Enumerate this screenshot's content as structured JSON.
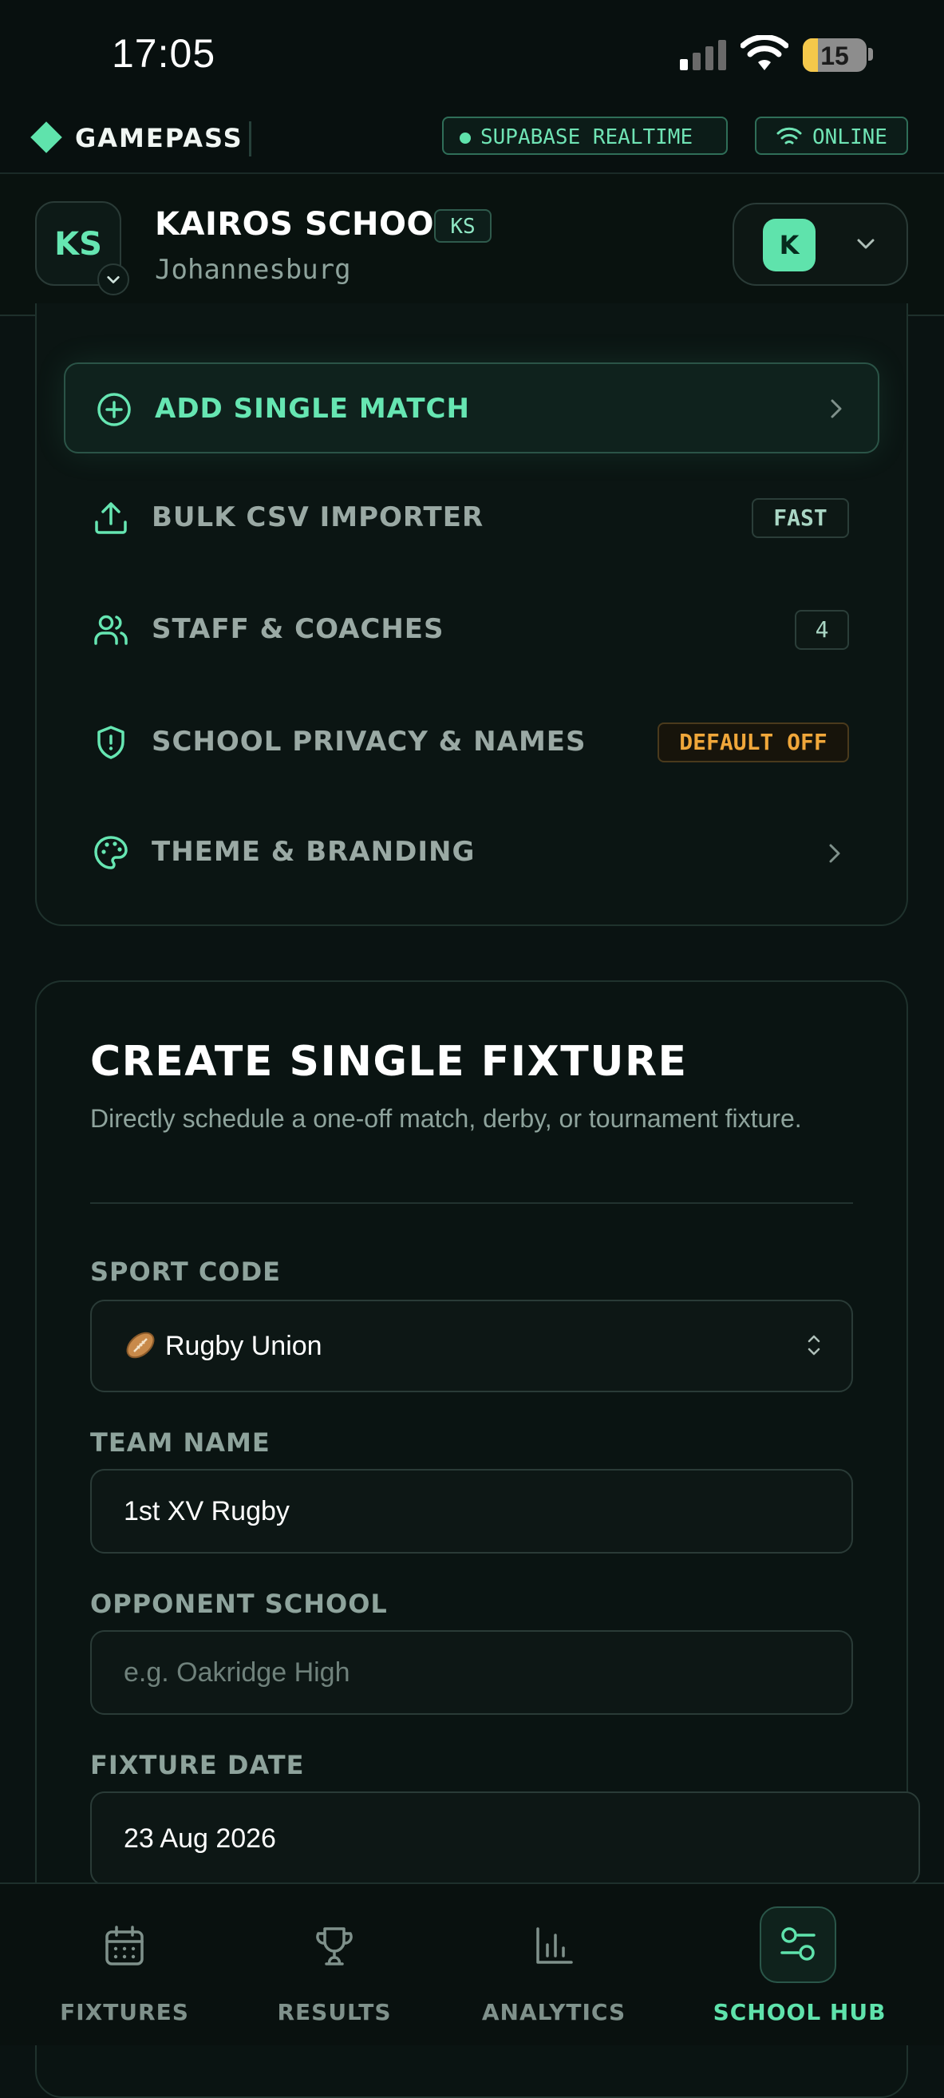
{
  "status_bar": {
    "time": "17:05",
    "battery": "15",
    "battery_level": 0.15
  },
  "app_bar": {
    "brand": "GAMEPASS",
    "realtime_label": "SUPABASE REALTIME",
    "online_label": "ONLINE"
  },
  "school": {
    "initials": "KS",
    "name": "KAIROS SCHOOL",
    "tag": "KS",
    "city": "Johannesburg",
    "user_initial": "K"
  },
  "menu": {
    "add_match": "ADD SINGLE MATCH",
    "items": [
      {
        "label": "BULK CSV IMPORTER",
        "badge": "FAST"
      },
      {
        "label": "STAFF & COACHES",
        "badge": "4"
      },
      {
        "label": "SCHOOL PRIVACY & NAMES",
        "badge": "DEFAULT OFF"
      },
      {
        "label": "THEME & BRANDING"
      }
    ]
  },
  "fixture": {
    "title": "CREATE SINGLE FIXTURE",
    "subtitle": "Directly schedule a one-off match, derby, or tournament fixture.",
    "sport_label": "SPORT CODE",
    "sport_value": "Rugby Union",
    "team_label": "TEAM NAME",
    "team_value": "1st XV Rugby",
    "opponent_label": "OPPONENT SCHOOL",
    "opponent_placeholder": "e.g. Oakridge High",
    "date_label": "FIXTURE DATE",
    "date_value": "23 Aug 2026"
  },
  "bottom_nav": [
    {
      "label": "FIXTURES",
      "icon": "calendar-icon"
    },
    {
      "label": "RESULTS",
      "icon": "trophy-icon"
    },
    {
      "label": "ANALYTICS",
      "icon": "bar-chart-icon"
    },
    {
      "label": "SCHOOL HUB",
      "icon": "sliders-icon",
      "active": true
    }
  ],
  "colors": {
    "accent": "#5fe3ac",
    "warning": "#f0a73a",
    "background": "#0a1312"
  }
}
